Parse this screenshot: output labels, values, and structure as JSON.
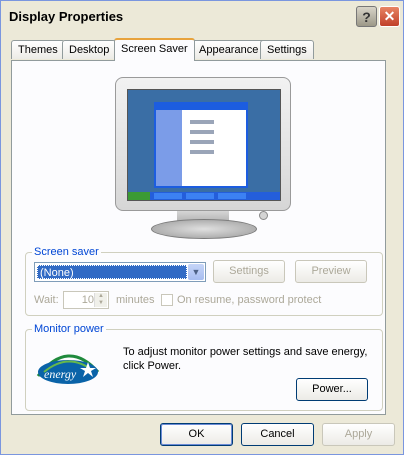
{
  "window": {
    "title": "Display Properties",
    "help_symbol": "?",
    "close_symbol": "✕"
  },
  "tabs": [
    "Themes",
    "Desktop",
    "Screen Saver",
    "Appearance",
    "Settings"
  ],
  "active_tab": "Screen Saver",
  "screen_saver": {
    "group_label": "Screen saver",
    "selected": "(None)",
    "settings_label": "Settings",
    "preview_label": "Preview",
    "wait_label": "Wait:",
    "wait_value": "10",
    "minutes_label": "minutes",
    "resume_label": "On resume, password protect",
    "resume_checked": false
  },
  "monitor_power": {
    "group_label": "Monitor power",
    "description": "To adjust monitor power settings and save energy, click Power.",
    "power_label": "Power...",
    "logo_text": "energy"
  },
  "footer": {
    "ok_label": "OK",
    "cancel_label": "Cancel",
    "apply_label": "Apply"
  },
  "colors": {
    "titlebar_text": "#000000",
    "active_tab_accent": "#e8a33c",
    "selection": "#316ac5",
    "group_label": "#0046d5"
  }
}
